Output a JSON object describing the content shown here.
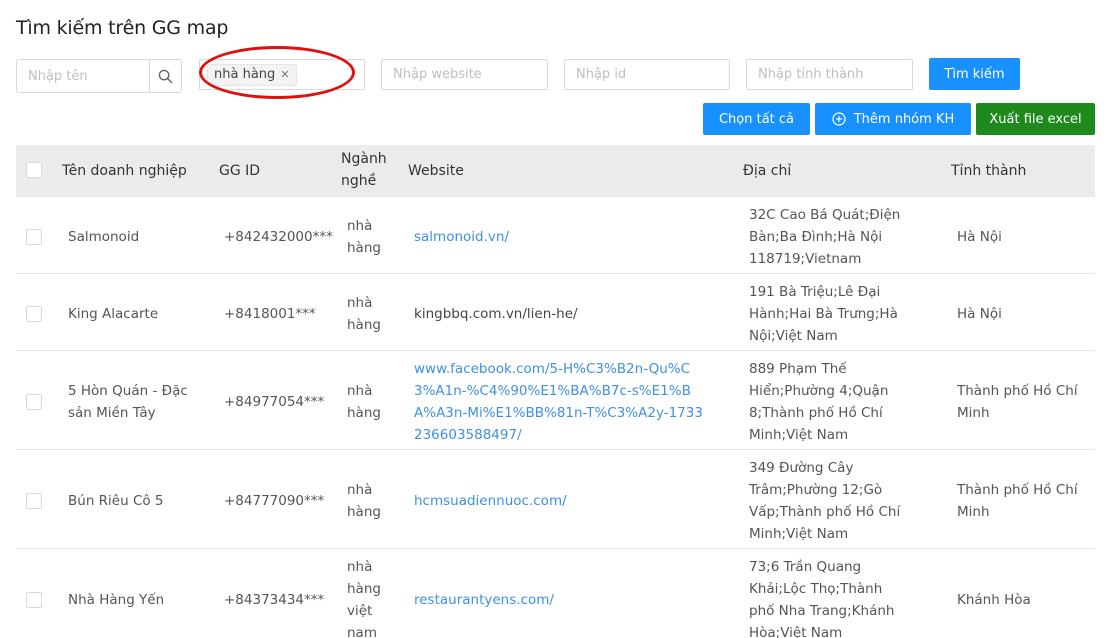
{
  "page": {
    "title": "Tìm kiếm trên GG map"
  },
  "filters": {
    "name_placeholder": "Nhập tên",
    "industry_tag": "nhà hàng",
    "website_placeholder": "Nhập website",
    "id_placeholder": "Nhập id",
    "province_placeholder": "Nhập tỉnh thành",
    "search_label": "Tìm kiếm"
  },
  "actions": {
    "select_all": "Chọn tất cả",
    "add_group": "Thêm nhóm KH",
    "export_excel": "Xuất file excel"
  },
  "table": {
    "headers": {
      "name": "Tên doanh nghiệp",
      "gg_id": "GG ID",
      "industry": "Ngành nghề",
      "website": "Website",
      "address": "Địa chỉ",
      "province": "Tỉnh thành"
    },
    "rows": [
      {
        "name": "Salmonoid",
        "gg_id": "+842432000***",
        "industry": "nhà hàng",
        "website": "salmonoid.vn/",
        "website_link": true,
        "address": "32C Cao Bá Quát;Điện Bàn;Ba Đình;Hà Nội 118719;Vietnam",
        "province": "Hà Nội"
      },
      {
        "name": "King Alacarte",
        "gg_id": "+8418001***",
        "industry": "nhà hàng",
        "website": "kingbbq.com.vn/lien-he/",
        "website_link": false,
        "address": "191 Bà Triệu;Lê Đại Hành;Hai Bà Trưng;Hà Nội;Việt Nam",
        "province": "Hà Nội"
      },
      {
        "name": "5 Hòn Quán - Đặc sản Miền Tây",
        "gg_id": "+84977054***",
        "industry": "nhà hàng",
        "website": "www.facebook.com/5-H%C3%B2n-Qu%C3%A1n-%C4%90%E1%BA%B7c-s%E1%BA%A3n-Mi%E1%BB%81n-T%C3%A2y-1733236603588497/",
        "website_link": true,
        "address": "889 Phạm Thế Hiển;Phường 4;Quận 8;Thành phố Hồ Chí Minh;Việt Nam",
        "province": "Thành phố Hồ Chí Minh"
      },
      {
        "name": "Bún Riêu Cô 5",
        "gg_id": "+84777090***",
        "industry": "nhà hàng",
        "website": "hcmsuadiennuoc.com/",
        "website_link": true,
        "address": "349 Đường Cây Trâm;Phường 12;Gò Vấp;Thành phố Hồ Chí Minh;Việt Nam",
        "province": "Thành phố Hồ Chí Minh"
      },
      {
        "name": "Nhà Hàng Yến",
        "gg_id": "+84373434***",
        "industry": "nhà hàng việt nam",
        "website": "restaurantyens.com/",
        "website_link": true,
        "address": "73;6 Trần Quang Khải;Lộc Thọ;Thành phố Nha Trang;Khánh Hòa;Việt Nam",
        "province": "Khánh Hòa"
      }
    ]
  },
  "colors": {
    "primary": "#1890ff",
    "success": "#1e8a1e",
    "link": "#3f8fe6",
    "highlight": "#e20f0f",
    "header_bg": "#ebebeb"
  }
}
